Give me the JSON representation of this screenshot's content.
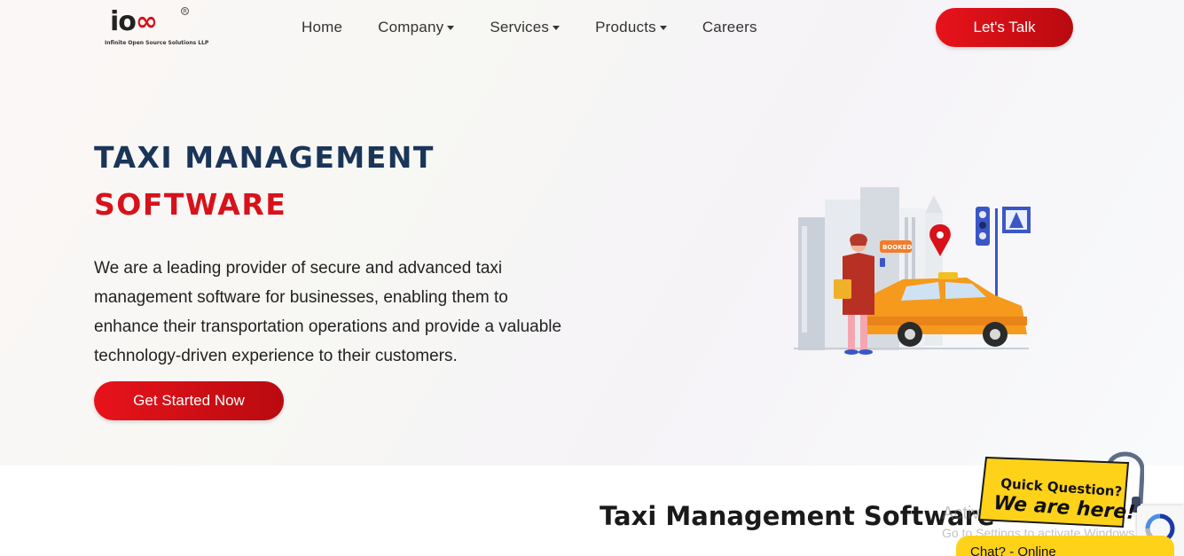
{
  "header": {
    "logo_text_i": "i",
    "logo_text_o": "o",
    "logo_text_oo": "∞",
    "logo_tagline": "Infinite Open Source Solutions LLP",
    "nav": [
      {
        "label": "Home",
        "has_dropdown": false
      },
      {
        "label": "Company",
        "has_dropdown": true
      },
      {
        "label": "Services",
        "has_dropdown": true
      },
      {
        "label": "Products",
        "has_dropdown": true
      },
      {
        "label": "Careers",
        "has_dropdown": false
      }
    ],
    "cta_label": "Let's Talk"
  },
  "hero": {
    "title_line1": "TAXI MANAGEMENT",
    "title_line2": "SOFTWARE",
    "description": "We are a leading provider of secure and advanced taxi management software for businesses, enabling them to enhance their transportation operations and provide a valuable technology-driven experience to their customers.",
    "button_label": "Get Started Now",
    "illustration_badge": "BOOKED"
  },
  "section": {
    "title": "Taxi Management Software"
  },
  "watermark": {
    "line1": "Activate Windows",
    "line2": "Go to Settings to activate Windows."
  },
  "chat": {
    "badge_line1": "Quick Question?",
    "badge_line2": "We are here!",
    "bar_label": "Chat? - Online"
  },
  "colors": {
    "brand_red": "#d8121b",
    "navy": "#1a3558",
    "chat_yellow": "#ffd21a"
  },
  "icons": [
    "logo-icon",
    "caret-down-icon",
    "taxi-illustration",
    "headset-icon",
    "recaptcha-icon"
  ]
}
